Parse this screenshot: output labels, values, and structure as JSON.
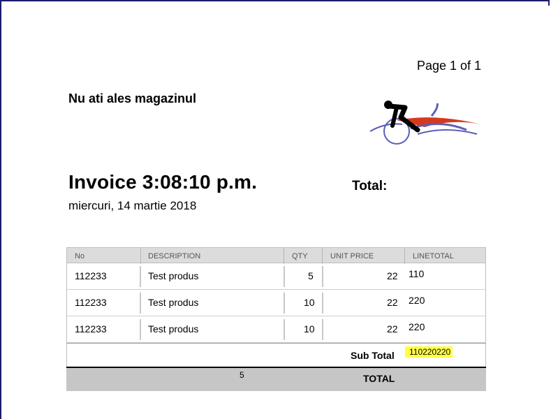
{
  "page_label": "Page 1 of 1",
  "store_name": "Nu ati ales magazinul",
  "invoice_title": "Invoice 3:08:10 p.m.",
  "invoice_date": "miercuri, 14 martie 2018",
  "total_label": "Total:",
  "table": {
    "headers": [
      "No",
      "DESCRIPTION",
      "QTY",
      "UNIT PRICE",
      "LINETOTAL"
    ],
    "rows": [
      {
        "no": "112233",
        "description": "Test produs",
        "qty": "5",
        "unit_price": "22",
        "line_total": "110"
      },
      {
        "no": "112233",
        "description": "Test produs",
        "qty": "10",
        "unit_price": "22",
        "line_total": "220"
      },
      {
        "no": "112233",
        "description": "Test produs",
        "qty": "10",
        "unit_price": "22",
        "line_total": "220"
      }
    ],
    "subtotal_label": "Sub Total",
    "subtotal_value": "110220220",
    "total_count": "5",
    "total_label": "TOTAL"
  },
  "colors": {
    "frame": "#1b1b6b",
    "highlight": "#ffff44",
    "logo_red": "#d63a1e",
    "logo_blue": "#5a5fb8"
  },
  "icons": {
    "logo": "cyclist-logo"
  }
}
